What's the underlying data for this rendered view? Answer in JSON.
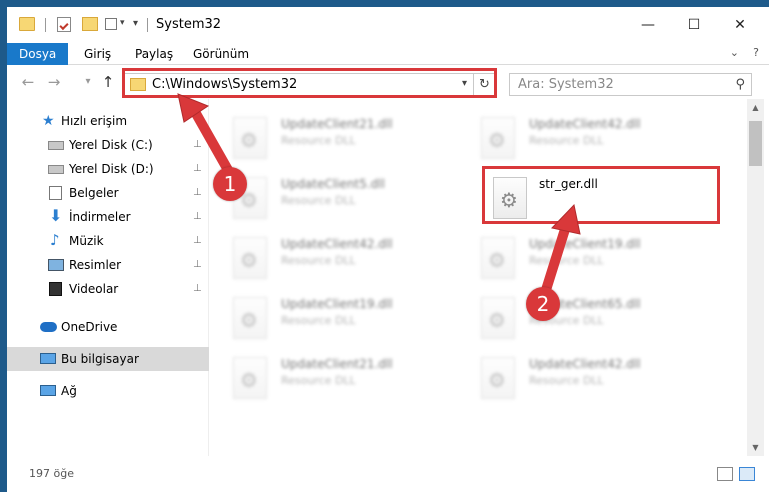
{
  "window": {
    "title": "System32",
    "min_glyph": "—",
    "max_glyph": "☐",
    "close_glyph": "✕"
  },
  "quick_access": {
    "dropdown_glyph": "▾"
  },
  "ribbon": {
    "tabs": [
      "Dosya",
      "Giriş",
      "Paylaş",
      "Görünüm"
    ],
    "active_tab": "Dosya",
    "help_glyph": "?"
  },
  "nav": {
    "back_glyph": "←",
    "forward_glyph": "→",
    "recent_glyph": "▾",
    "up_glyph": "↑"
  },
  "address": {
    "path": "C:\\Windows\\System32",
    "dropdown_glyph": "▾",
    "refresh_glyph": "↻"
  },
  "search": {
    "placeholder": "Ara: System32",
    "icon_glyph": "⚲"
  },
  "sidebar": {
    "items": [
      {
        "label": "Hızlı erişim",
        "icon": "star-icon",
        "pinned": false
      },
      {
        "label": "Yerel Disk (C:)",
        "icon": "drive-icon",
        "pinned": true
      },
      {
        "label": "Yerel Disk (D:)",
        "icon": "drive-icon",
        "pinned": true
      },
      {
        "label": "Belgeler",
        "icon": "documents-icon",
        "pinned": true
      },
      {
        "label": "İndirmeler",
        "icon": "download-icon",
        "pinned": true
      },
      {
        "label": "Müzik",
        "icon": "music-icon",
        "pinned": true
      },
      {
        "label": "Resimler",
        "icon": "pictures-icon",
        "pinned": true
      },
      {
        "label": "Videolar",
        "icon": "videos-icon",
        "pinned": true
      },
      {
        "label": "OneDrive",
        "icon": "cloud-icon",
        "pinned": false
      },
      {
        "label": "Bu bilgisayar",
        "icon": "computer-icon",
        "pinned": false,
        "selected": true
      },
      {
        "label": "Ağ",
        "icon": "network-icon",
        "pinned": false
      }
    ],
    "pin_glyph": "📌"
  },
  "files": [
    {
      "name": "UpdateClient21.dll",
      "type": "Resource DLL",
      "blurred": true
    },
    {
      "name": "UpdateClient42.dll",
      "type": "Resource DLL",
      "blurred": true
    },
    {
      "name": "UpdateClient5.dll",
      "type": "Resource DLL",
      "blurred": true
    },
    {
      "name": "str_ger.dll",
      "type": "",
      "blurred": false
    },
    {
      "name": "UpdateClient42.dll",
      "type": "Resource DLL",
      "blurred": true
    },
    {
      "name": "UpdateClient19.dll",
      "type": "Resource DLL",
      "blurred": true
    },
    {
      "name": "UpdateClient19.dll",
      "type": "Resource DLL",
      "blurred": true
    },
    {
      "name": "UpdateClient65.dll",
      "type": "Resource DLL",
      "blurred": true
    },
    {
      "name": "UpdateClient21.dll",
      "type": "Resource DLL",
      "blurred": true
    },
    {
      "name": "UpdateClient42.dll",
      "type": "Resource DLL",
      "blurred": true
    }
  ],
  "status": {
    "item_count": "197 öğe"
  },
  "annotations": {
    "step1": "1",
    "step2": "2",
    "color": "#d9383a"
  }
}
